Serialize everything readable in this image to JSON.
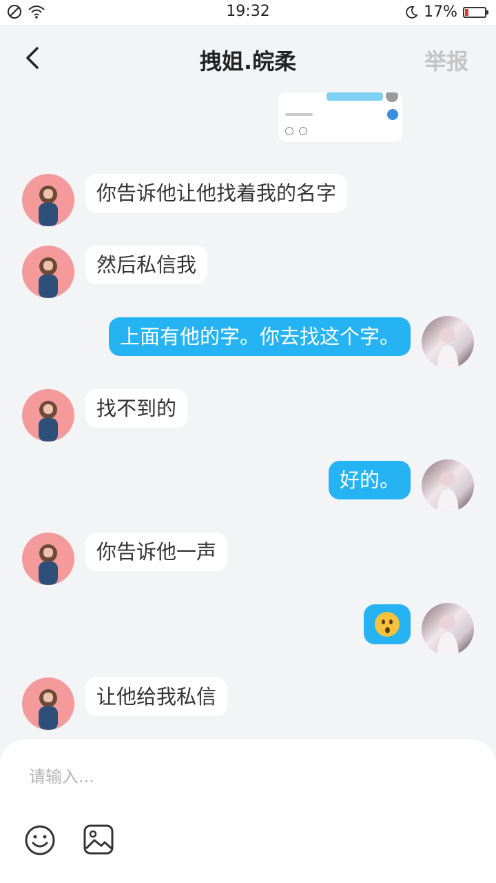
{
  "status_bar": {
    "time": "19:32",
    "battery_percent": "17%",
    "icons": [
      "do-not-disturb-icon",
      "wifi-icon",
      "moon-icon",
      "battery-icon"
    ]
  },
  "header": {
    "title": "拽姐.皖柔",
    "report_label": "举报",
    "back_icon": "chevron-left-icon"
  },
  "messages": [
    {
      "side": "left",
      "text": "你告诉他让他找着我的名字"
    },
    {
      "side": "left",
      "text": "然后私信我"
    },
    {
      "side": "right",
      "text": "上面有他的字。你去找这个字。"
    },
    {
      "side": "left",
      "text": "找不到的"
    },
    {
      "side": "right",
      "text": "好的。"
    },
    {
      "side": "left",
      "text": "你告诉他一声"
    },
    {
      "side": "right",
      "emoji": "hushed-face-emoji"
    },
    {
      "side": "left",
      "text": "让他给我私信"
    }
  ],
  "composer": {
    "placeholder": "请输入...",
    "value": "",
    "icons": [
      "emoji-icon",
      "image-icon"
    ]
  },
  "colors": {
    "background": "#f3f4f6",
    "sent_bubble": "#26b3f3",
    "received_bubble": "#ffffff",
    "report_text": "#c4c4c4",
    "battery_low": "#e53935"
  }
}
